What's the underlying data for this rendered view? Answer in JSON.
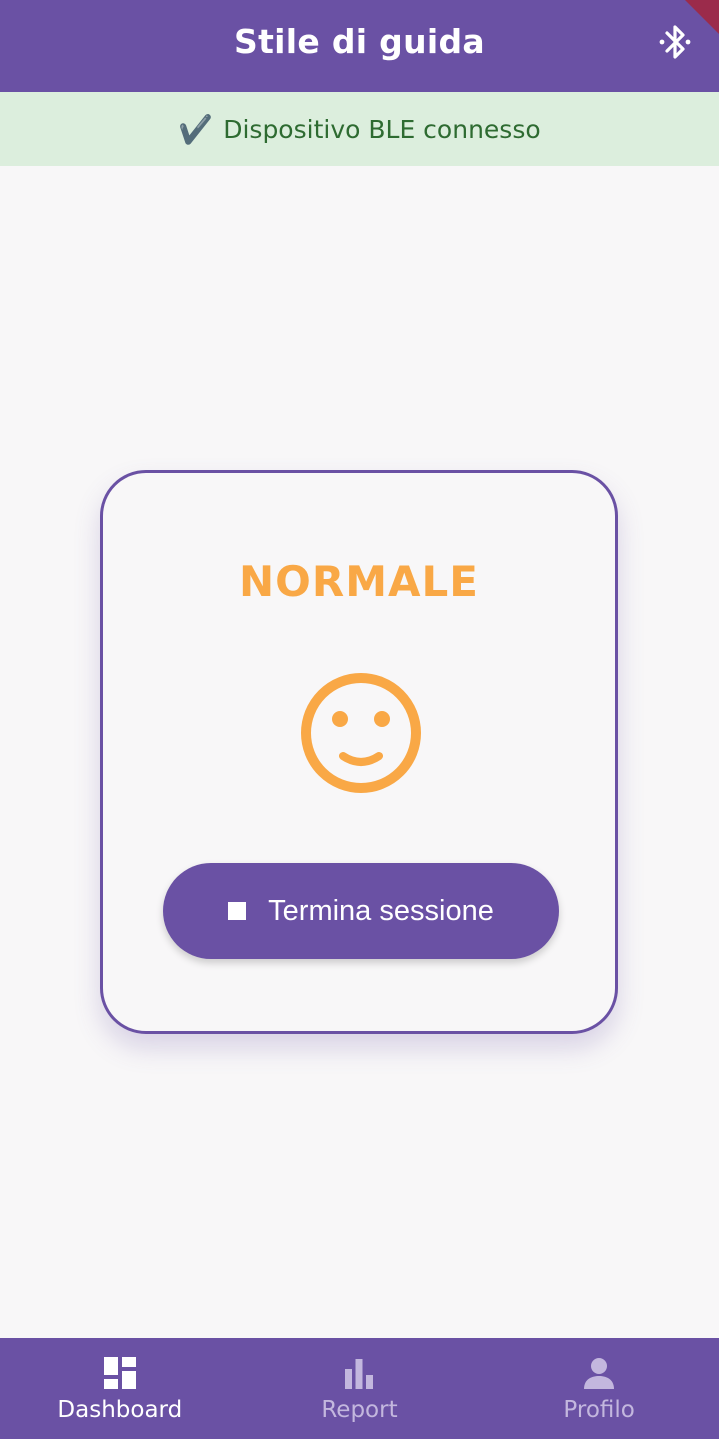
{
  "appbar": {
    "title": "Stile di guida",
    "bluetooth_icon": "bluetooth-icon"
  },
  "banner": {
    "check_icon": "✔️",
    "text": "Dispositivo BLE connesso"
  },
  "card": {
    "status": "NORMALE",
    "face_icon": "smiley-face-icon",
    "end_button_label": "Termina sessione"
  },
  "nav": {
    "items": [
      {
        "label": "Dashboard",
        "icon": "dashboard-icon",
        "active": true
      },
      {
        "label": "Report",
        "icon": "bar-chart-icon",
        "active": false
      },
      {
        "label": "Profilo",
        "icon": "person-icon",
        "active": false
      }
    ]
  },
  "colors": {
    "primary": "#6a51a4",
    "accent": "#f9a846",
    "banner_bg": "#dceedd",
    "banner_text": "#2e6b31"
  }
}
